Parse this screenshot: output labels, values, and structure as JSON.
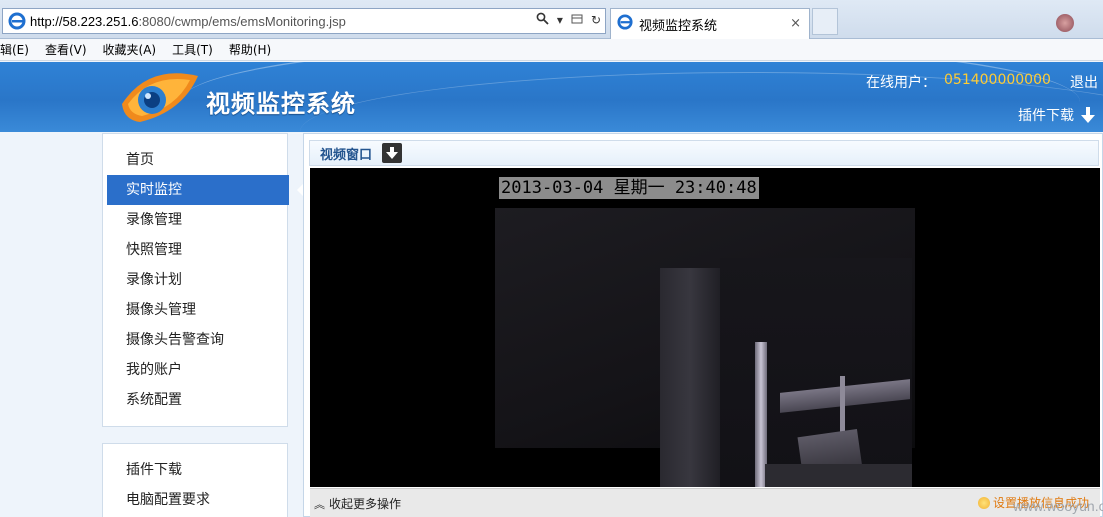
{
  "browser": {
    "url_host": "http://58.223.251.6",
    "url_rest": ":8080/cwmp/ems/emsMonitoring.jsp",
    "tab_title": "视频监控系统",
    "tab_close": "×"
  },
  "menubar": {
    "items": [
      "辑(E)",
      "查看(V)",
      "收藏夹(A)",
      "工具(T)",
      "帮助(H)"
    ]
  },
  "header": {
    "title": "视频监控系统",
    "online_label": "在线用户：",
    "online_user": "051400000000",
    "logout": "退出",
    "plugin_download": "插件下载"
  },
  "sidebar": {
    "menu": [
      "首页",
      "实时监控",
      "录像管理",
      "快照管理",
      "录像计划",
      "摄像头管理",
      "摄像头告警查询",
      "我的账户",
      "系统配置"
    ],
    "active_index": 1,
    "menu2": [
      "插件下载",
      "电脑配置要求"
    ]
  },
  "main": {
    "video_title": "视频窗口",
    "osd_timestamp": "2013-03-04 星期一 23:40:48",
    "collapse_label": "收起更多操作",
    "status_message": "设置播放信息成功"
  },
  "watermark": "www.wooyun.org",
  "colors": {
    "header_blue": "#2a76c8",
    "active_item": "#2b6fca",
    "user_highlight": "#ffcc33",
    "status_orange": "#e07a10"
  }
}
